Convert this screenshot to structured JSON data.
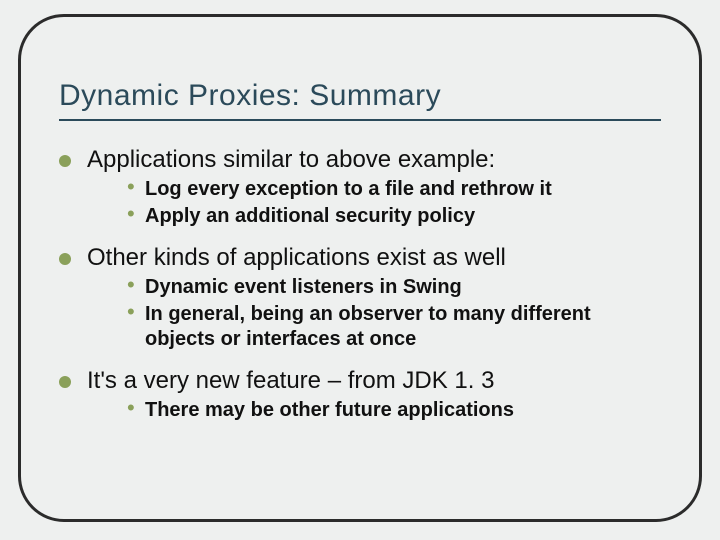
{
  "slide": {
    "title": "Dynamic Proxies: Summary",
    "bullets": [
      {
        "text": "Applications similar to above example:",
        "sub": [
          "Log every exception to a file and rethrow it",
          "Apply an additional security policy"
        ]
      },
      {
        "text": "Other kinds of applications exist as well",
        "sub": [
          "Dynamic event listeners in Swing",
          "In general, being an observer to many different objects or interfaces at once"
        ]
      },
      {
        "text": "It's a very new feature – from JDK 1. 3",
        "sub": [
          "There may be other future applications"
        ]
      }
    ]
  }
}
